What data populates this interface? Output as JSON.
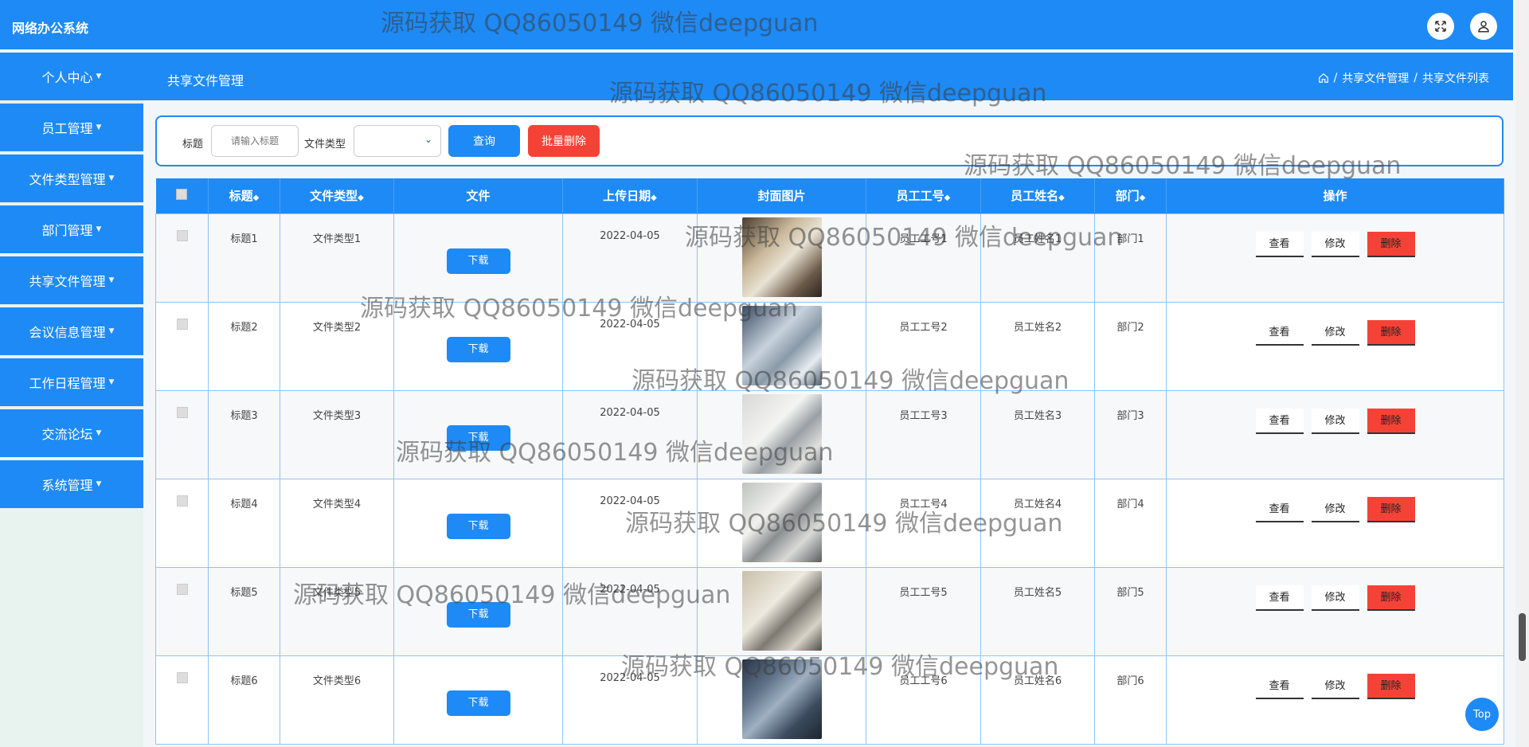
{
  "app": {
    "title": "网络办公系统"
  },
  "subbar": {
    "title": "共享文件管理"
  },
  "breadcrumb": [
    "共享文件管理",
    "共享文件列表"
  ],
  "sidebar": {
    "items": [
      {
        "label": "个人中心"
      },
      {
        "label": "员工管理"
      },
      {
        "label": "文件类型管理"
      },
      {
        "label": "部门管理"
      },
      {
        "label": "共享文件管理"
      },
      {
        "label": "会议信息管理"
      },
      {
        "label": "工作日程管理"
      },
      {
        "label": "交流论坛"
      },
      {
        "label": "系统管理"
      }
    ]
  },
  "search": {
    "title_label": "标题",
    "title_placeholder": "请输入标题",
    "type_label": "文件类型",
    "query_button": "查询",
    "batch_delete_button": "批量删除"
  },
  "table": {
    "headers": [
      "标题",
      "文件类型",
      "文件",
      "上传日期",
      "封面图片",
      "员工工号",
      "员工姓名",
      "部门",
      "操作"
    ],
    "download_label": "下载",
    "view_label": "查看",
    "edit_label": "修改",
    "delete_label": "删除",
    "rows": [
      {
        "title": "标题1",
        "type": "文件类型1",
        "date": "2022-04-05",
        "emp_no": "员工工号1",
        "emp_name": "员工姓名1",
        "dept": "部门1"
      },
      {
        "title": "标题2",
        "type": "文件类型2",
        "date": "2022-04-05",
        "emp_no": "员工工号2",
        "emp_name": "员工姓名2",
        "dept": "部门2"
      },
      {
        "title": "标题3",
        "type": "文件类型3",
        "date": "2022-04-05",
        "emp_no": "员工工号3",
        "emp_name": "员工姓名3",
        "dept": "部门3"
      },
      {
        "title": "标题4",
        "type": "文件类型4",
        "date": "2022-04-05",
        "emp_no": "员工工号4",
        "emp_name": "员工姓名4",
        "dept": "部门4"
      },
      {
        "title": "标题5",
        "type": "文件类型5",
        "date": "2022-04-05",
        "emp_no": "员工工号5",
        "emp_name": "员工姓名5",
        "dept": "部门5"
      },
      {
        "title": "标题6",
        "type": "文件类型6",
        "date": "2022-04-05",
        "emp_no": "员工工号6",
        "emp_name": "员工姓名6",
        "dept": "部门6"
      }
    ]
  },
  "watermark": {
    "text": "源码获取 QQ86050149 微信deepguan"
  },
  "top_button": {
    "label": "Top"
  },
  "colors": {
    "primary": "#1e8af5",
    "danger": "#f44336"
  }
}
